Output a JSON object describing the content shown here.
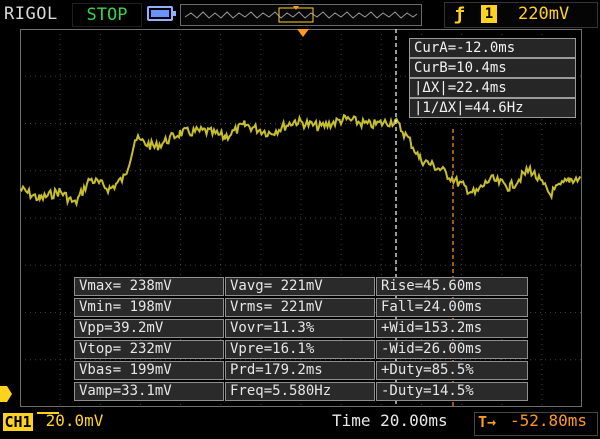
{
  "brand": "RIGOL",
  "run_state": "STOP",
  "trigger": {
    "channel": "1",
    "level": "220mV",
    "edge_icon": "rising-edge-icon"
  },
  "cursors": [
    {
      "label": "CurA",
      "value": "-12.0ms"
    },
    {
      "label": "CurB",
      "value": "10.4ms"
    },
    {
      "label": "|ΔX|",
      "value": "22.4ms"
    },
    {
      "label": "|1/ΔX|",
      "value": "44.6Hz"
    }
  ],
  "measurements": [
    [
      "Vmax= 238mV",
      "Vavg= 221mV",
      "Rise=45.60ms"
    ],
    [
      "Vmin= 198mV",
      "Vrms= 221mV",
      "Fall=24.00ms"
    ],
    [
      "Vpp=39.2mV",
      "Vovr=11.3%",
      "+Wid=153.2ms"
    ],
    [
      "Vtop= 232mV",
      "Vpre=16.1%",
      "-Wid=26.00ms"
    ],
    [
      "Vbas= 199mV",
      "Prd=179.2ms",
      "+Duty=85.5%"
    ],
    [
      "Vamp=33.1mV",
      "Freq=5.580Hz",
      "-Duty=14.5%"
    ]
  ],
  "channel": {
    "label": "CH1",
    "scale": "20.0mV"
  },
  "timebase": "Time 20.00ms",
  "trigger_position": "-52.80ms",
  "colors": {
    "ch1": "#c8bf2c",
    "trigger": "#ffd21f",
    "cursor_a": "#ff9a1e",
    "cursor_b": "#ffffff"
  }
}
